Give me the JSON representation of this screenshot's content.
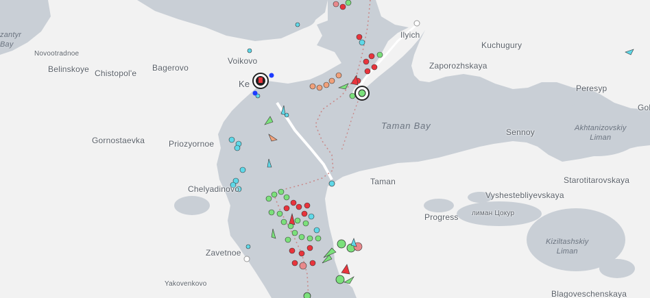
{
  "map": {
    "place_labels": [
      {
        "id": "novootradnoe",
        "text": "Novootradnoe"
      },
      {
        "id": "belinskoye",
        "text": "Belinskoye"
      },
      {
        "id": "chistopole",
        "text": "Chistopol'e"
      },
      {
        "id": "bagerovo",
        "text": "Bagerovo"
      },
      {
        "id": "voikovo",
        "text": "Voikovo"
      },
      {
        "id": "kerch",
        "text": "Ke"
      },
      {
        "id": "gornostaevka",
        "text": "Gornostaevka"
      },
      {
        "id": "priozyornoe",
        "text": "Priozyornoe"
      },
      {
        "id": "chelyadinovo",
        "text": "Chelyadinovo"
      },
      {
        "id": "zavetnoe",
        "text": "Zavetnoe"
      },
      {
        "id": "yakovenkovo",
        "text": "Yakovenkovo"
      },
      {
        "id": "ilyich",
        "text": "Ilyich"
      },
      {
        "id": "kuchugury",
        "text": "Kuchugury"
      },
      {
        "id": "zaporozhskaya",
        "text": "Zaporozhskaya"
      },
      {
        "id": "peresyp",
        "text": "Peresyp"
      },
      {
        "id": "gol",
        "text": "Gol"
      },
      {
        "id": "sennoy",
        "text": "Sennoy"
      },
      {
        "id": "taman",
        "text": "Taman"
      },
      {
        "id": "vyshestebliyevskaya",
        "text": "Vyshestebliyevskaya"
      },
      {
        "id": "starotitarovskaya",
        "text": "Starotitarovskaya"
      },
      {
        "id": "progress",
        "text": "Progress"
      },
      {
        "id": "liman_tsokur",
        "text": "лиман Цокур"
      },
      {
        "id": "blagoveschenskaya",
        "text": "Blagoveschenskaya"
      }
    ],
    "water_labels": [
      {
        "id": "azantyr",
        "lines": [
          "zantyr",
          "Bay"
        ]
      },
      {
        "id": "taman_bay",
        "lines": [
          "Taman Bay"
        ]
      },
      {
        "id": "akhtanizovskiy",
        "lines": [
          "Akhtanizovskiy",
          "Liman"
        ]
      },
      {
        "id": "kiziltashskiy",
        "lines": [
          "Kiziltashskiy",
          "Liman"
        ]
      }
    ],
    "colors": {
      "water": "#c9cfd6",
      "land": "#f2f2f2",
      "road": "#ffffff",
      "route": "#c98a8a",
      "vessel_cargo": "#7be07b",
      "vessel_tanker": "#e8343c",
      "vessel_passenger": "#5fd8e8",
      "vessel_tug": "#f0a07a",
      "vessel_unknown": "#c8c8c8",
      "vessel_pleasure": "#1e3cff",
      "port": "#222222"
    },
    "icons": [
      "port-icon",
      "vessel-circle-icon",
      "vessel-arrow-icon"
    ]
  }
}
